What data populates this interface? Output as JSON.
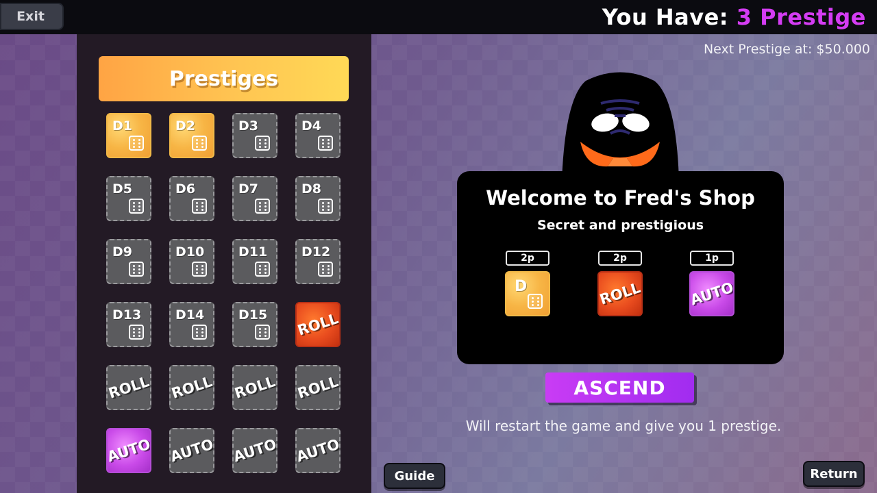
{
  "topbar": {
    "exit_label": "Exit",
    "prestige_prefix": "You Have: ",
    "prestige_value": "3 Prestige",
    "prestige_color": "#d43cf3"
  },
  "next_prestige": "Next Prestige at: $50.000",
  "panel": {
    "title": "Prestiges",
    "tiles": [
      {
        "label": "D1",
        "kind": "dice",
        "style": "gold"
      },
      {
        "label": "D2",
        "kind": "dice",
        "style": "gold"
      },
      {
        "label": "D3",
        "kind": "dice",
        "style": "locked"
      },
      {
        "label": "D4",
        "kind": "dice",
        "style": "locked"
      },
      {
        "label": "D5",
        "kind": "dice",
        "style": "locked"
      },
      {
        "label": "D6",
        "kind": "dice",
        "style": "locked"
      },
      {
        "label": "D7",
        "kind": "dice",
        "style": "locked"
      },
      {
        "label": "D8",
        "kind": "dice",
        "style": "locked"
      },
      {
        "label": "D9",
        "kind": "dice",
        "style": "locked"
      },
      {
        "label": "D10",
        "kind": "dice",
        "style": "locked"
      },
      {
        "label": "D11",
        "kind": "dice",
        "style": "locked"
      },
      {
        "label": "D12",
        "kind": "dice",
        "style": "locked"
      },
      {
        "label": "D13",
        "kind": "dice",
        "style": "locked"
      },
      {
        "label": "D14",
        "kind": "dice",
        "style": "locked"
      },
      {
        "label": "D15",
        "kind": "dice",
        "style": "locked"
      },
      {
        "label": "ROLL",
        "kind": "text",
        "style": "fire"
      },
      {
        "label": "ROLL",
        "kind": "text",
        "style": "locked"
      },
      {
        "label": "ROLL",
        "kind": "text",
        "style": "locked"
      },
      {
        "label": "ROLL",
        "kind": "text",
        "style": "locked"
      },
      {
        "label": "ROLL",
        "kind": "text",
        "style": "locked"
      },
      {
        "label": "AUTO",
        "kind": "text",
        "style": "purple"
      },
      {
        "label": "AUTO",
        "kind": "text",
        "style": "locked"
      },
      {
        "label": "AUTO",
        "kind": "text",
        "style": "locked"
      },
      {
        "label": "AUTO",
        "kind": "text",
        "style": "locked"
      }
    ]
  },
  "shop": {
    "title": "Welcome to Fred's Shop",
    "subtitle": "Secret and prestigious",
    "items": [
      {
        "price": "2p",
        "label": "D",
        "kind": "dice",
        "style": "gold"
      },
      {
        "price": "2p",
        "label": "ROLL",
        "kind": "text",
        "style": "fire"
      },
      {
        "price": "1p",
        "label": "AUTO",
        "kind": "text",
        "style": "purple"
      }
    ]
  },
  "ascend": {
    "label": "ASCEND",
    "note": "Will restart the game and give you 1 prestige."
  },
  "guide_label": "Guide",
  "return_label": "Return"
}
